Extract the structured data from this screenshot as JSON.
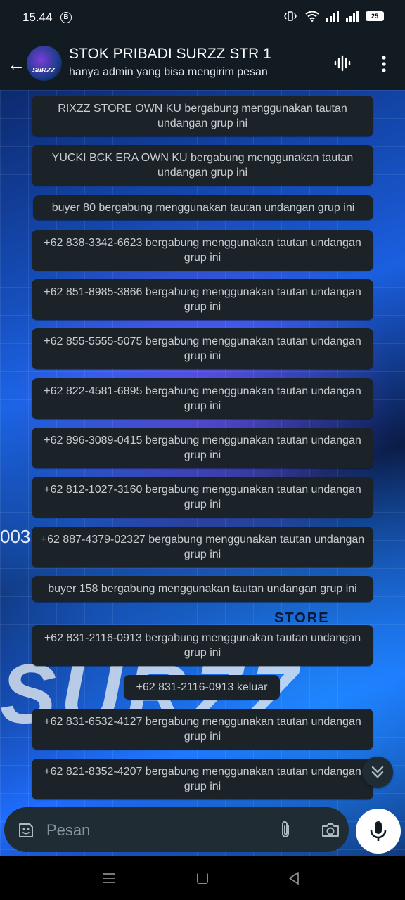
{
  "status": {
    "time": "15.44",
    "battery": "25"
  },
  "header": {
    "title": "STOK PRIBADI SURZZ STR 1",
    "subtitle": "hanya admin yang bisa mengirim pesan",
    "avatar_text": "SuRZZ"
  },
  "wallpaper": {
    "text1": "003",
    "text2": "STORE",
    "text3": "SURZZ"
  },
  "messages": [
    "RIXZZ STORE OWN KU bergabung menggunakan tautan undangan grup ini",
    "YUCKI BCK ERA OWN KU bergabung menggunakan tautan undangan grup ini",
    "buyer 80 bergabung menggunakan tautan undangan grup ini",
    "+62 838-3342-6623 bergabung menggunakan tautan undangan grup ini",
    "+62 851-8985-3866 bergabung menggunakan tautan undangan grup ini",
    "+62 855-5555-5075 bergabung menggunakan tautan undangan grup ini",
    "+62 822-4581-6895 bergabung menggunakan tautan undangan grup ini",
    "+62 896-3089-0415 bergabung menggunakan tautan undangan grup ini",
    "+62 812-1027-3160 bergabung menggunakan tautan undangan grup ini",
    "+62 887-4379-02327 bergabung menggunakan tautan undangan grup ini",
    "buyer 158 bergabung menggunakan tautan undangan grup ini",
    "+62 831-2116-0913 bergabung menggunakan tautan undangan grup ini",
    "+62 831-2116-0913 keluar",
    "+62 831-6532-4127 bergabung menggunakan tautan undangan grup ini",
    "+62 821-8352-4207 bergabung menggunakan tautan undangan grup ini"
  ],
  "input": {
    "placeholder": "Pesan"
  }
}
